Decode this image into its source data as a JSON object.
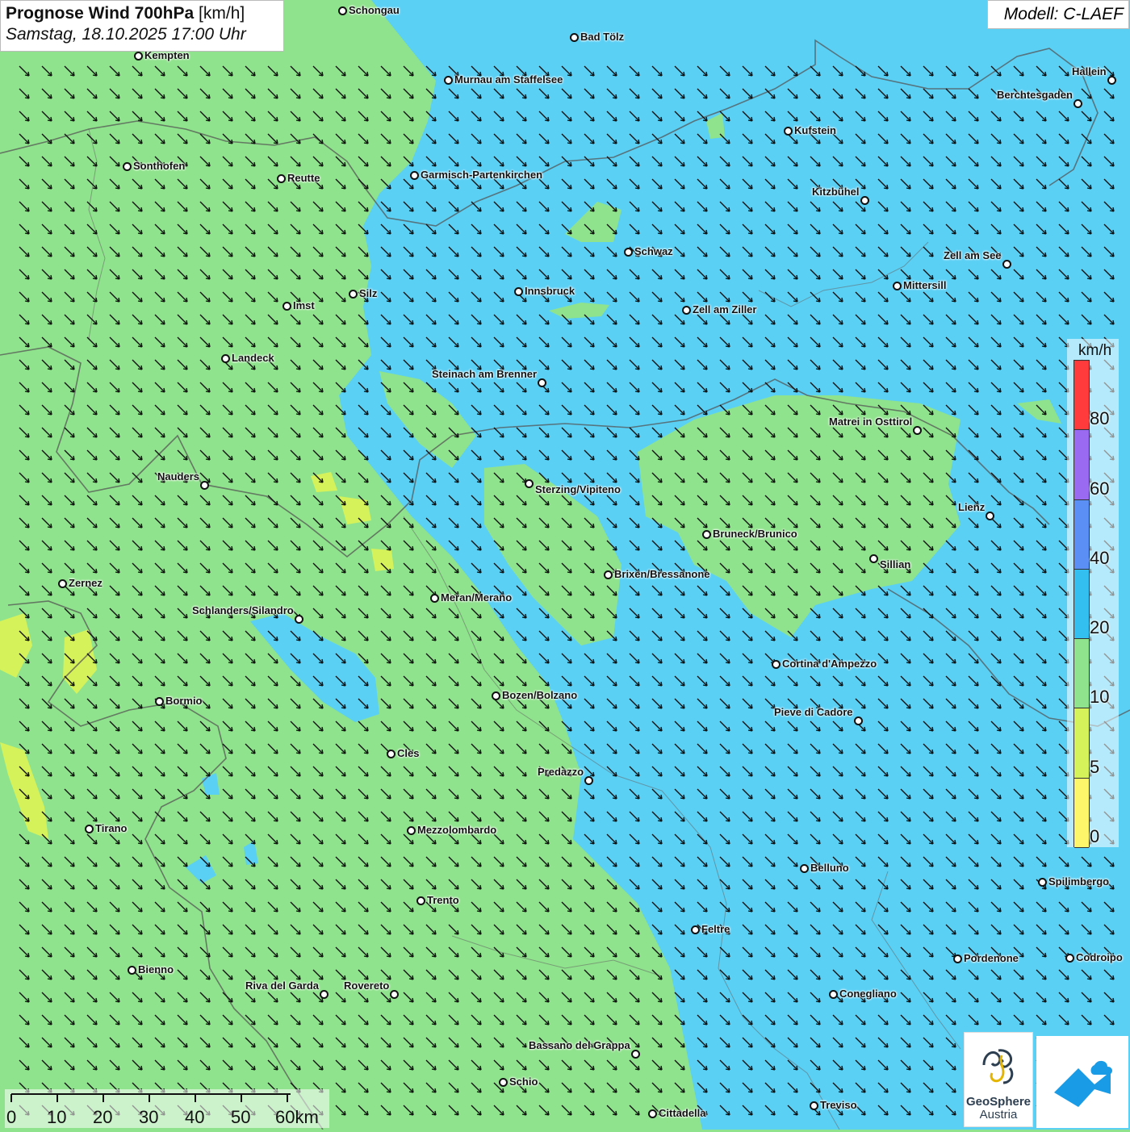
{
  "header": {
    "title_bold": "Prognose Wind 700hPa",
    "title_unit": "[km/h]",
    "subtitle": "Samstag, 18.10.2025 17:00 Uhr"
  },
  "model_label": "Modell: C-LAEF",
  "logo": {
    "line1": "GeoSphere",
    "line2": "Austria"
  },
  "legend": {
    "unit": "km/h",
    "labels": [
      "80",
      "60",
      "40",
      "20",
      "10",
      "5",
      "0"
    ],
    "colors": [
      "#ff3b3b",
      "#9a6bf0",
      "#5b8ff5",
      "#33c0f0",
      "#8fe38c",
      "#d6f25a",
      "#fdf56a"
    ]
  },
  "scale_bar": {
    "labels": [
      "0",
      "10",
      "20",
      "30",
      "40",
      "50",
      "60km"
    ]
  },
  "colors": {
    "calm_green": "#8fe38c",
    "wind_blue": "#5ad0f5",
    "border": "#555555"
  },
  "wind_arrow_icon": "arrow-southeast-icon",
  "cities": [
    {
      "name": "Schongau"
    },
    {
      "name": "Bad Tölz"
    },
    {
      "name": "Kempten"
    },
    {
      "name": "Hallein"
    },
    {
      "name": "Murnau am Staffelsee"
    },
    {
      "name": "Berchtesgaden"
    },
    {
      "name": "Kufstein"
    },
    {
      "name": "Sonthofen"
    },
    {
      "name": "Reutte"
    },
    {
      "name": "Garmisch-Partenkirchen"
    },
    {
      "name": "Kitzbühel"
    },
    {
      "name": "Schwaz"
    },
    {
      "name": "Zell am See"
    },
    {
      "name": "Mittersill"
    },
    {
      "name": "Innsbruck"
    },
    {
      "name": "Silz"
    },
    {
      "name": "Imst"
    },
    {
      "name": "Zell am Ziller"
    },
    {
      "name": "Landeck"
    },
    {
      "name": "Steinach am Brenner"
    },
    {
      "name": "Matrei in Osttirol"
    },
    {
      "name": "Nauders"
    },
    {
      "name": "Sterzing/Vipiteno"
    },
    {
      "name": "Lienz"
    },
    {
      "name": "Bruneck/Brunico"
    },
    {
      "name": "Sillian"
    },
    {
      "name": "Zernez"
    },
    {
      "name": "Brixen/Bressanone"
    },
    {
      "name": "Meran/Merano"
    },
    {
      "name": "Schlanders/Silandro"
    },
    {
      "name": "Cortina d'Ampezzo"
    },
    {
      "name": "Bozen/Bolzano"
    },
    {
      "name": "Bormio"
    },
    {
      "name": "Pieve di Cadore"
    },
    {
      "name": "Cles"
    },
    {
      "name": "Predazzo"
    },
    {
      "name": "Tirano"
    },
    {
      "name": "Mezzolombardo"
    },
    {
      "name": "Belluno"
    },
    {
      "name": "Spilimbergo"
    },
    {
      "name": "Trento"
    },
    {
      "name": "Feltre"
    },
    {
      "name": "Pordenone"
    },
    {
      "name": "Codroipo"
    },
    {
      "name": "Bienno"
    },
    {
      "name": "Riva del Garda"
    },
    {
      "name": "Rovereto"
    },
    {
      "name": "Conegliano"
    },
    {
      "name": "Bassano del Grappa"
    },
    {
      "name": "Schio"
    },
    {
      "name": "Treviso"
    },
    {
      "name": "Cittadella"
    }
  ]
}
